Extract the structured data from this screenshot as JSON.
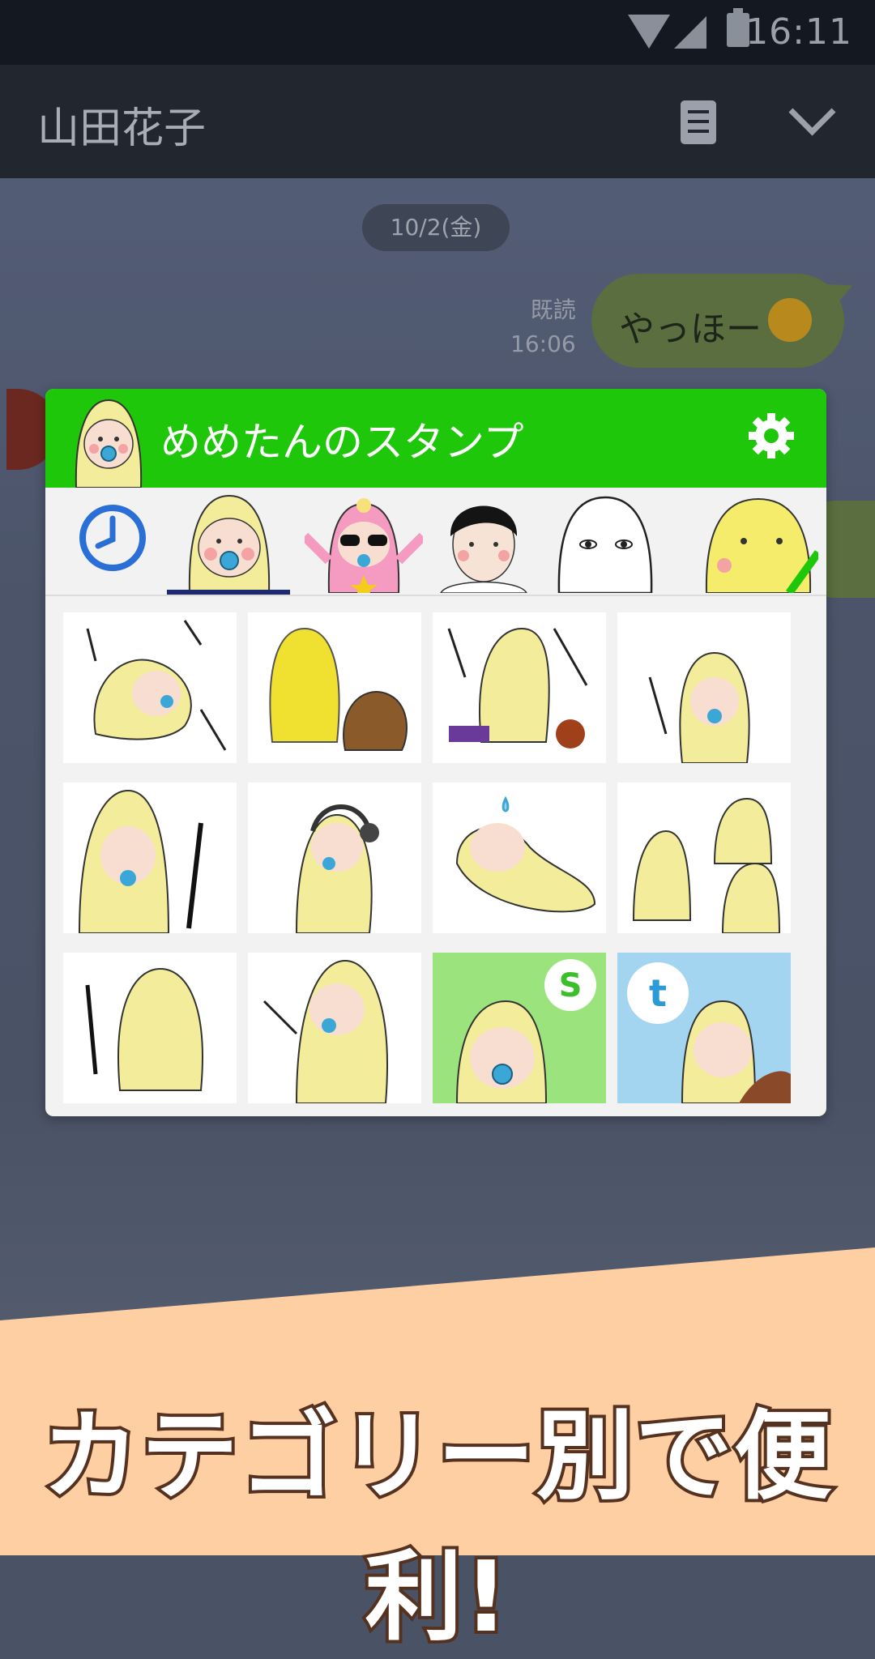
{
  "status_bar": {
    "time": "16:11"
  },
  "chat": {
    "contact_name": "山田花子",
    "date": "10/2(金)",
    "read_label": "既読",
    "read_time": "16:06",
    "message": "やっほー"
  },
  "sticker_panel": {
    "title": "めめたんのスタンプ",
    "tabs": [
      "recent",
      "memetan",
      "pink-character",
      "man",
      "white-ghost",
      "yellow-character"
    ],
    "selected_tab": "memetan",
    "stickers": [
      "sticker-1",
      "sticker-2",
      "sticker-3",
      "sticker-4",
      "sticker-5",
      "sticker-6",
      "sticker-7",
      "sticker-8",
      "sticker-9",
      "sticker-10",
      "sticker-11",
      "sticker-12"
    ],
    "share_badges": {
      "s": "S",
      "t": "t"
    }
  },
  "promo": {
    "caption": "カテゴリー別で便利!"
  },
  "colors": {
    "panel_header": "#1fc70a",
    "bubble": "#5a6e3f",
    "banner": "#ffcfa4"
  }
}
